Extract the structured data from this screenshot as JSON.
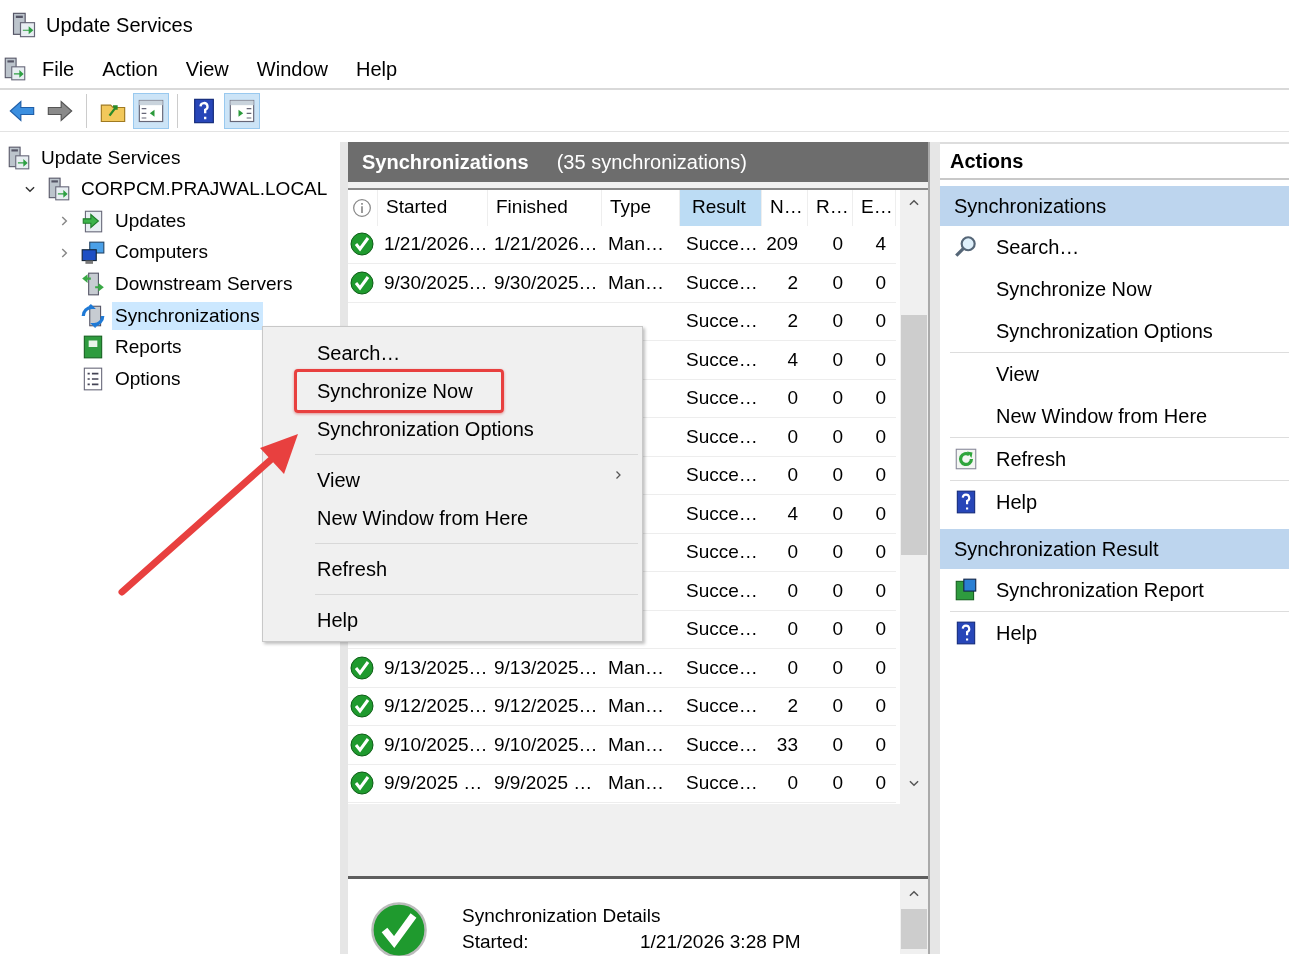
{
  "window": {
    "title": "Update Services"
  },
  "menu_bar": [
    {
      "label": "File"
    },
    {
      "label": "Action"
    },
    {
      "label": "View"
    },
    {
      "label": "Window"
    },
    {
      "label": "Help"
    }
  ],
  "toolbar": [
    {
      "kind": "back",
      "pressed": false
    },
    {
      "kind": "forward",
      "pressed": false
    },
    {
      "kind": "separator"
    },
    {
      "kind": "up",
      "pressed": false
    },
    {
      "kind": "tree-pane",
      "pressed": true
    },
    {
      "kind": "separator"
    },
    {
      "kind": "help",
      "pressed": false
    },
    {
      "kind": "action-pane",
      "pressed": true
    }
  ],
  "tree": [
    {
      "label": "Update Services",
      "kind": "root",
      "selected": false,
      "children": [
        {
          "label": "CORPCM.PRAJWAL.LOCAL",
          "kind": "server",
          "expanded": true,
          "selected": false,
          "children": [
            {
              "label": "Updates",
              "kind": "updates",
              "expanded": false,
              "selected": false
            },
            {
              "label": "Computers",
              "kind": "computers",
              "expanded": false,
              "selected": false
            },
            {
              "label": "Downstream Servers",
              "kind": "downstream",
              "selected": false
            },
            {
              "label": "Synchronizations",
              "kind": "sync",
              "selected": true
            },
            {
              "label": "Reports",
              "kind": "reports",
              "selected": false
            },
            {
              "label": "Options",
              "kind": "options",
              "selected": false
            }
          ]
        }
      ]
    }
  ],
  "center": {
    "title": "Synchronizations",
    "count": "(35 synchronizations)",
    "columns": [
      {
        "label": "Started",
        "selected": false
      },
      {
        "label": "Finished",
        "selected": false
      },
      {
        "label": "Type",
        "selected": false
      },
      {
        "label": "Result",
        "selected": true
      },
      {
        "label": "N…",
        "selected": false
      },
      {
        "label": "R…",
        "selected": false
      },
      {
        "label": "E…",
        "selected": false
      }
    ],
    "rows": [
      {
        "kind": "success",
        "started": "1/21/2026…",
        "finished": "1/21/2026…",
        "type": "Man…",
        "result": "Succe…",
        "n": "209",
        "r": "0",
        "e": "4"
      },
      {
        "kind": "success",
        "started": "9/30/2025…",
        "finished": "9/30/2025…",
        "type": "Man…",
        "result": "Succe…",
        "n": "2",
        "r": "0",
        "e": "0"
      },
      {
        "result": "Succe…",
        "n": "2",
        "r": "0",
        "e": "0"
      },
      {
        "result": "Succe…",
        "n": "4",
        "r": "0",
        "e": "0"
      },
      {
        "result": "Succe…",
        "n": "0",
        "r": "0",
        "e": "0"
      },
      {
        "result": "Succe…",
        "n": "0",
        "r": "0",
        "e": "0"
      },
      {
        "result": "Succe…",
        "n": "0",
        "r": "0",
        "e": "0"
      },
      {
        "result": "Succe…",
        "n": "4",
        "r": "0",
        "e": "0"
      },
      {
        "result": "Succe…",
        "n": "0",
        "r": "0",
        "e": "0"
      },
      {
        "result": "Succe…",
        "n": "0",
        "r": "0",
        "e": "0"
      },
      {
        "result": "Succe…",
        "n": "0",
        "r": "0",
        "e": "0"
      },
      {
        "kind": "success",
        "started": "9/13/2025…",
        "finished": "9/13/2025…",
        "type": "Man…",
        "result": "Succe…",
        "n": "0",
        "r": "0",
        "e": "0"
      },
      {
        "kind": "success",
        "started": "9/12/2025…",
        "finished": "9/12/2025…",
        "type": "Man…",
        "result": "Succe…",
        "n": "2",
        "r": "0",
        "e": "0"
      },
      {
        "kind": "success",
        "started": "9/10/2025…",
        "finished": "9/10/2025…",
        "type": "Man…",
        "result": "Succe…",
        "n": "33",
        "r": "0",
        "e": "0"
      },
      {
        "kind": "success",
        "started": "9/9/2025 …",
        "finished": "9/9/2025 …",
        "type": "Man…",
        "result": "Succe…",
        "n": "0",
        "r": "0",
        "e": "0"
      }
    ],
    "details": {
      "kind": "success",
      "title": "Synchronization Details",
      "fields": [
        {
          "label": "Started:",
          "value": "1/21/2026 3:28 PM"
        }
      ]
    }
  },
  "context_menu": {
    "items": [
      {
        "kind": "item",
        "label": "Search…",
        "submenu": false,
        "highlighted": false
      },
      {
        "kind": "item",
        "label": "Synchronize Now",
        "submenu": false,
        "highlighted": true
      },
      {
        "kind": "item",
        "label": "Synchronization Options",
        "submenu": false,
        "highlighted": false
      },
      {
        "kind": "separator"
      },
      {
        "kind": "item",
        "label": "View",
        "submenu": true,
        "highlighted": false
      },
      {
        "kind": "item",
        "label": "New Window from Here",
        "submenu": false,
        "highlighted": false
      },
      {
        "kind": "separator"
      },
      {
        "kind": "item",
        "label": "Refresh",
        "submenu": false,
        "highlighted": false
      },
      {
        "kind": "separator"
      },
      {
        "kind": "item",
        "label": "Help",
        "submenu": false,
        "highlighted": false
      }
    ]
  },
  "actions": {
    "title": "Actions",
    "sections": [
      {
        "title": "Synchronizations",
        "items": [
          {
            "kind": "search",
            "label": "Search…"
          },
          {
            "kind": "plain",
            "label": "Synchronize Now"
          },
          {
            "kind": "plain",
            "label": "Synchronization Options"
          },
          {
            "kind": "separator"
          },
          {
            "kind": "plain",
            "label": "View"
          },
          {
            "kind": "plain",
            "label": "New Window from Here"
          },
          {
            "kind": "separator"
          },
          {
            "kind": "refresh",
            "label": "Refresh"
          },
          {
            "kind": "separator"
          },
          {
            "kind": "help",
            "label": "Help"
          }
        ]
      },
      {
        "title": "Synchronization Result",
        "items": [
          {
            "kind": "report",
            "label": "Synchronization Report"
          },
          {
            "kind": "separator"
          },
          {
            "kind": "help",
            "label": "Help"
          }
        ]
      }
    ]
  }
}
